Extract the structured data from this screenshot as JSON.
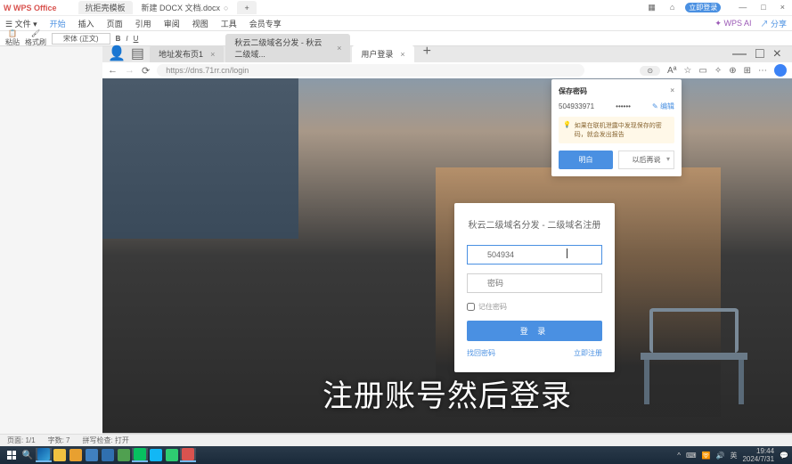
{
  "wps": {
    "logo": "W WPS Office",
    "login_btn": "立即登录",
    "share": "分享",
    "tabs": [
      {
        "label": "抗拒壳模板"
      },
      {
        "label": "新建 DOCX 文档.docx",
        "active": true
      }
    ],
    "menu": {
      "file": "文件"
    },
    "ribbon": [
      "开始",
      "插入",
      "页面",
      "引用",
      "审阅",
      "视图",
      "工具",
      "会员专享"
    ],
    "ai": "WPS AI",
    "paste": "粘贴",
    "copy": "格式刷",
    "font": "宋体 (正文)"
  },
  "browser": {
    "tabs": [
      {
        "label": "地址发布页1"
      },
      {
        "label": "秋云二级域名分发 - 秋云二级域..."
      },
      {
        "label": "用户登录",
        "active": true
      }
    ],
    "url": "https://dns.71rr.cn/login"
  },
  "login": {
    "title": "秋云二级域名分发 - 二级域名注册",
    "username": "504934",
    "pw_placeholder": "密码",
    "remember": "记住密码",
    "submit": "登 录",
    "forgot": "找回密码",
    "register": "立即注册"
  },
  "save_pw": {
    "title": "保存密码",
    "user": "504933971",
    "dots": "••••••",
    "edit": "编辑",
    "warn": "如果在联机泄露中发现保存的密码，就会发出报告",
    "ok": "明白",
    "later": "以后再说"
  },
  "subtitle": "注册账号然后登录",
  "status": {
    "page": "页面: 1/1",
    "words": "字数: 7",
    "spell": "拼写检查: 打开"
  },
  "tray": {
    "time": "19:44",
    "date": "2024/7/31"
  }
}
